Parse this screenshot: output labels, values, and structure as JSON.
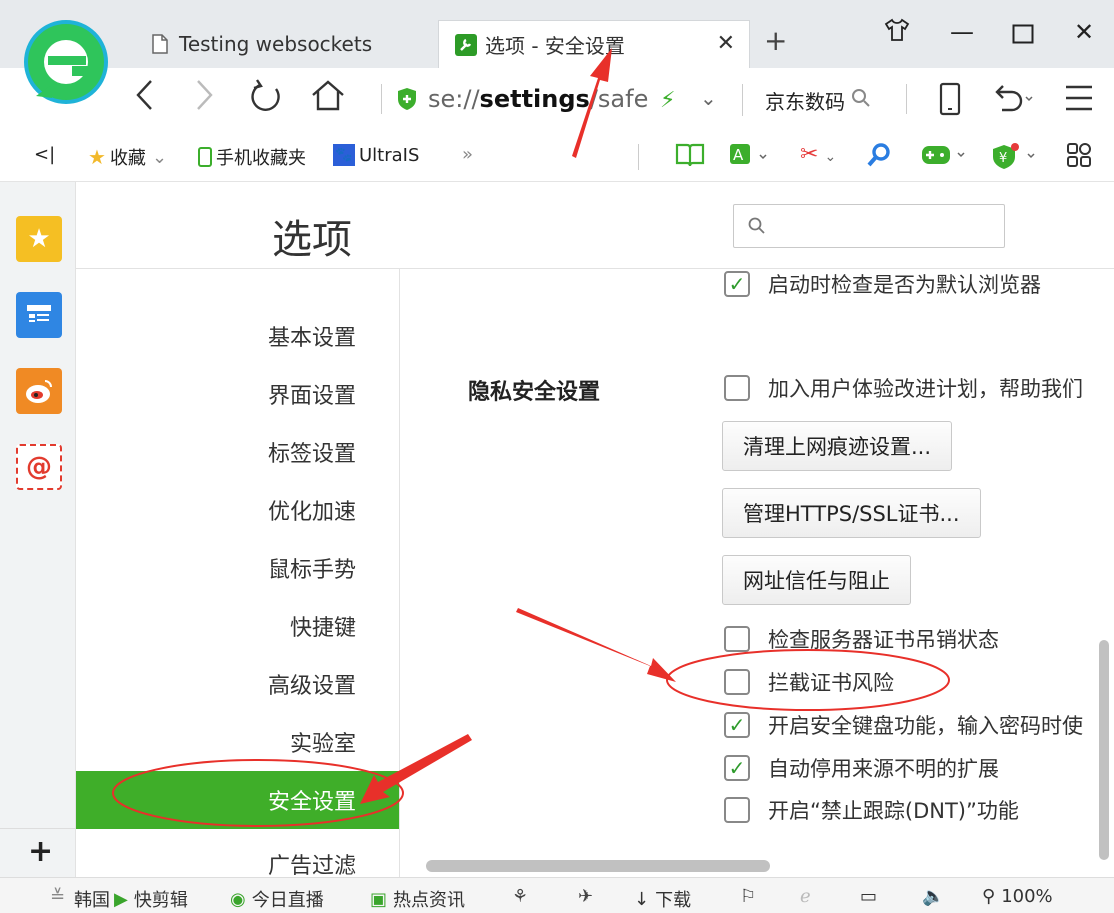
{
  "tabs": [
    {
      "label": "Testing websockets",
      "icon": "page-icon"
    },
    {
      "label": "选项 - 安全设置",
      "icon": "wrench-icon"
    }
  ],
  "address": {
    "scheme": "se://",
    "host": "settings",
    "path": "/safe"
  },
  "search_box": {
    "text": "京东数码"
  },
  "bookmarks": [
    {
      "label": "收藏",
      "icon": "star-icon"
    },
    {
      "label": "手机收藏夹",
      "icon": "phone-icon"
    },
    {
      "label": "UltraIS",
      "icon": "paw-icon"
    }
  ],
  "options": {
    "title": "选项",
    "search_placeholder": "",
    "nav": [
      "基本设置",
      "界面设置",
      "标签设置",
      "优化加速",
      "鼠标手势",
      "快捷键",
      "高级设置",
      "实验室",
      "安全设置",
      "广告过滤"
    ],
    "active_nav": "安全设置",
    "section_label": "隐私安全设置",
    "checkboxes": [
      {
        "label": "启动时检查是否为默认浏览器",
        "checked": true
      },
      {
        "label": "加入用户体验改进计划，帮助我们",
        "checked": false
      },
      {
        "label": "检查服务器证书吊销状态",
        "checked": false
      },
      {
        "label": "拦截证书风险",
        "checked": false
      },
      {
        "label": "开启安全键盘功能，输入密码时使",
        "checked": true
      },
      {
        "label": "自动停用来源不明的扩展",
        "checked": true
      },
      {
        "label": "开启“禁止跟踪(DNT)”功能",
        "checked": false
      }
    ],
    "buttons": [
      "清理上网痕迹设置...",
      "管理HTTPS/SSL证书...",
      "网址信任与阻止"
    ]
  },
  "statusbar": {
    "items": [
      "韩国",
      "快剪辑",
      "今日直播",
      "热点资讯",
      "下载"
    ],
    "zoom": "100%"
  },
  "colors": {
    "accent": "#3fae29",
    "annotation": "#e8302a"
  }
}
